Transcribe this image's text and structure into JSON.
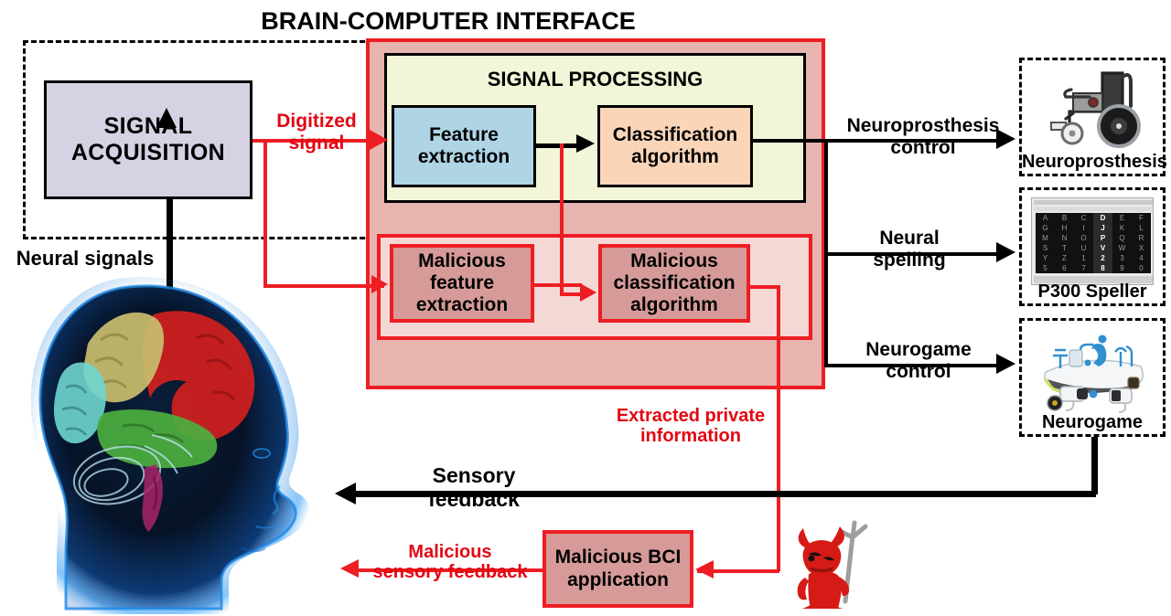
{
  "title": "BRAIN-COMPUTER INTERFACE",
  "colors": {
    "danger_red": "#ee1d23",
    "text_red": "#e30613",
    "signal_acquisition_fill": "#d6d2e4",
    "signal_processing_fill": "#f2f5d7",
    "feature_extraction_fill": "#aed4e6",
    "classification_fill": "#fbd5b8",
    "malicious_fill": "#d69b99",
    "attack_frame_fill": "#e8b4b0"
  },
  "bci": {
    "signal_acquisition": "SIGNAL\nACQUISITION",
    "signal_processing_title": "SIGNAL PROCESSING",
    "feature_extraction": "Feature\nextraction",
    "classification": "Classification\nalgorithm"
  },
  "malicious": {
    "feature_extraction": "Malicious\nfeature\nextraction",
    "classification": "Malicious\nclassification\nalgorithm",
    "application": "Malicious BCI\napplication"
  },
  "flows": {
    "neural_signals": "Neural signals",
    "digitized_signal": "Digitized\nsignal",
    "neuroprosthesis_control": "Neuroprosthesis\ncontrol",
    "neural_spelling": "Neural\nspelling",
    "neurogame_control": "Neurogame\ncontrol",
    "sensory_feedback": "Sensory\nfeedback",
    "malicious_sensory_feedback": "Malicious\nsensory feedback",
    "extracted_private_information": "Extracted private\ninformation"
  },
  "devices": [
    {
      "caption": "Neuroprosthesis",
      "icon": "wheelchair-icon"
    },
    {
      "caption": "P300 Speller",
      "icon": "p300-speller-icon"
    },
    {
      "caption": "Neurogame",
      "icon": "neurogame-icon"
    }
  ],
  "speller_grid": [
    [
      "A",
      "B",
      "C",
      "D",
      "E",
      "F"
    ],
    [
      "G",
      "H",
      "I",
      "J",
      "K",
      "L"
    ],
    [
      "M",
      "N",
      "O",
      "P",
      "Q",
      "R"
    ],
    [
      "S",
      "T",
      "U",
      "V",
      "W",
      "X"
    ],
    [
      "Y",
      "Z",
      "1",
      "2",
      "3",
      "4"
    ],
    [
      "5",
      "6",
      "7",
      "8",
      "9",
      "0"
    ]
  ],
  "speller_highlight_column": 3,
  "attacker": {
    "icon": "devil-icon"
  },
  "subject": {
    "icon": "human-head-brain-icon"
  }
}
